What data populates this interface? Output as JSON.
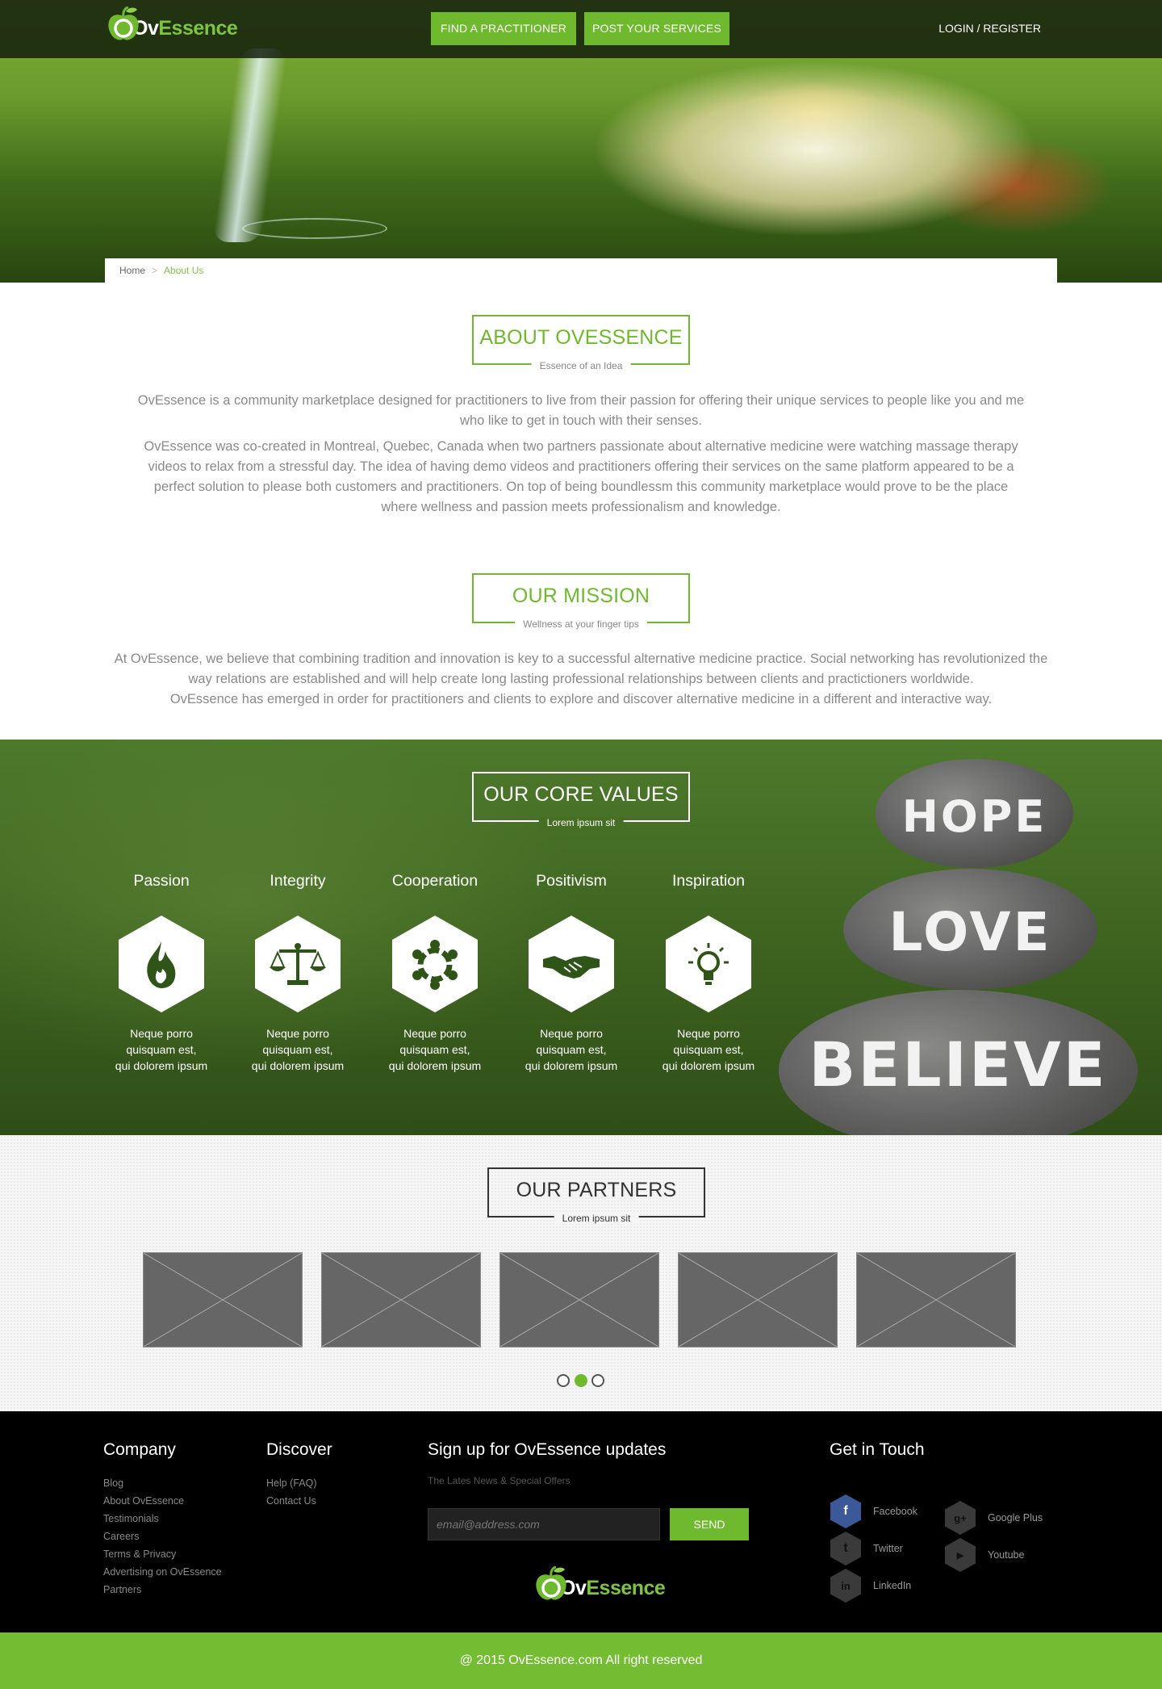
{
  "nav": {
    "logo_ov": "Ov",
    "logo_essence": "Essence",
    "find_practitioner": "FIND A PRACTITIONER",
    "post_services": "POST YOUR SERVICES",
    "login": "LOGIN / REGISTER"
  },
  "breadcrumb": {
    "home": "Home",
    "current": "About Us"
  },
  "about": {
    "title": "ABOUT OVESSENCE",
    "subtitle": "Essence of an Idea",
    "p1": "OvEssence is a community marketplace designed for practitioners to live from their passion for offering their unique services to people like you and me who like to get in touch with their senses.",
    "p2": "OvEssence was co-created in Montreal, Quebec, Canada when two partners passionate about alternative medicine were watching massage therapy videos to relax from a stressful day. The idea of having demo videos and practitioners offering their services on the same platform appeared to be a perfect solution to please both customers and practitioners. On top of being boundlessm this community marketplace would prove to be the place where wellness and passion meets professionalism and knowledge."
  },
  "mission": {
    "title": "OUR MISSION",
    "subtitle": "Wellness at your finger tips",
    "p1": "At OvEssence, we believe that combining tradition and innovation is key to a successful alternative medicine practice. Social networking has revolutionized the way relations are established and will help create long lasting professional relationships between clients and practictioners worldwide.",
    "p2": "OvEssence has emerged in order for practitioners and clients to explore and discover alternative medicine in a different and interactive way."
  },
  "core": {
    "title": "OUR CORE VALUES",
    "subtitle": "Lorem ipsum sit",
    "stones": [
      "HOPE",
      "LOVE",
      "BELIEVE"
    ],
    "values": [
      {
        "name": "Passion",
        "icon": "flame-icon",
        "l1": "Neque porro",
        "l2": "quisquam est,",
        "l3": "qui dolorem ipsum"
      },
      {
        "name": "Integrity",
        "icon": "scales-icon",
        "l1": "Neque porro",
        "l2": "quisquam est,",
        "l3": "qui dolorem ipsum"
      },
      {
        "name": "Cooperation",
        "icon": "people-circle-icon",
        "l1": "Neque porro",
        "l2": "quisquam est,",
        "l3": "qui dolorem ipsum"
      },
      {
        "name": "Positivism",
        "icon": "handshake-icon",
        "l1": "Neque porro",
        "l2": "quisquam est,",
        "l3": "qui dolorem ipsum"
      },
      {
        "name": "Inspiration",
        "icon": "lightbulb-icon",
        "l1": "Neque porro",
        "l2": "quisquam est,",
        "l3": "qui dolorem ipsum"
      }
    ]
  },
  "partners": {
    "title": "OUR PARTNERS",
    "subtitle": "Lorem ipsum sit",
    "carousel_active_index": 1,
    "carousel_pages": 3
  },
  "footer": {
    "company_heading": "Company",
    "company_links": [
      "Blog",
      "About OvEssence",
      "Testimonials",
      "Careers",
      "Terms & Privacy",
      "Advertising on OvEssence",
      "Partners"
    ],
    "discover_heading": "Discover",
    "discover_links": [
      "Help (FAQ)",
      "Contact Us"
    ],
    "signup_heading": "Sign up for OvEssence updates",
    "signup_sub": "The Lates News &  Special Offers",
    "email_placeholder": "email@address.com",
    "send": "SEND",
    "touch_heading": "Get in Touch",
    "social": {
      "facebook": "Facebook",
      "twitter": "Twitter",
      "linkedin": "LinkedIn",
      "googleplus": "Google Plus",
      "youtube": "Youtube"
    },
    "copyright": "@ 2015 OvEssence.com All right reserved"
  },
  "colors": {
    "brand_green": "#6fb92e",
    "footer_bg": "#000000",
    "copyright_bg": "#74bd32"
  }
}
